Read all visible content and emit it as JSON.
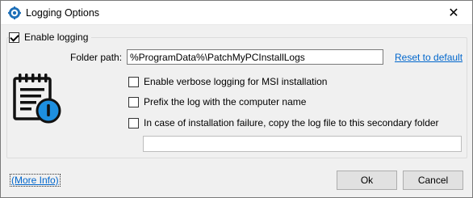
{
  "window": {
    "title": "Logging Options",
    "close_glyph": "✕",
    "app_icon": "gear-shield-icon"
  },
  "logging": {
    "enable_label": "Enable logging",
    "enable_checked": true,
    "folder_label": "Folder path:",
    "folder_value": "%ProgramData%\\PatchMyPCInstallLogs",
    "reset_label": "Reset to default",
    "icon": "log-file-icon",
    "options": [
      {
        "label": "Enable verbose logging for MSI installation",
        "checked": false
      },
      {
        "label": "Prefix the log with the computer name",
        "checked": false
      },
      {
        "label": "In case of installation failure, copy the log file to this secondary folder",
        "checked": false
      }
    ],
    "secondary_value": ""
  },
  "footer": {
    "more_info": "(More Info)",
    "ok_label": "Ok",
    "cancel_label": "Cancel"
  },
  "colors": {
    "link": "#0066cc",
    "icon_blue": "#1d8fe0"
  }
}
